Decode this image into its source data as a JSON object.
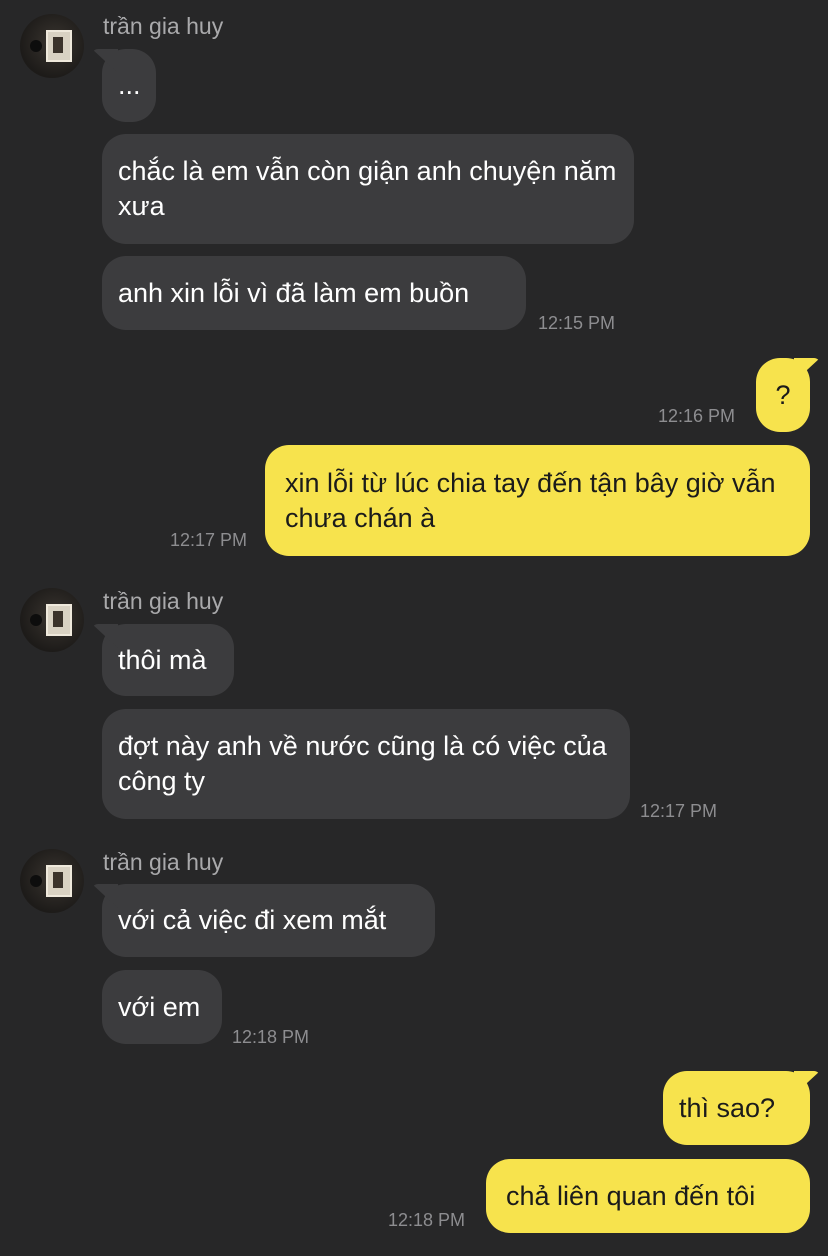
{
  "messages": [
    {
      "sender": "trần gia huy",
      "texts": [
        "...",
        "chắc là em vẫn còn giận anh chuyện năm xưa",
        "anh xin lỗi vì đã làm em buồn"
      ],
      "time": "12:15 PM"
    },
    {
      "outgoing_1": "?",
      "time": "12:16 PM"
    },
    {
      "outgoing_2": "xin lỗi từ lúc chia tay đến tận bây giờ vẫn chưa chán à",
      "time": "12:17 PM"
    },
    {
      "sender": "trần gia huy",
      "texts": [
        "thôi mà",
        "đợt này anh về nước cũng là có việc của công ty"
      ],
      "time": "12:17 PM"
    },
    {
      "sender": "trần gia huy",
      "texts": [
        "với cả việc đi xem mắt",
        "với em"
      ],
      "time": "12:18 PM"
    },
    {
      "outgoing": [
        "thì sao?",
        "chả liên quan đến tôi"
      ],
      "time": "12:18 PM"
    }
  ],
  "colors": {
    "background": "#272728",
    "incoming": "#3c3c3e",
    "outgoing": "#f7e34d"
  },
  "icons": {
    "avatar": "profile-photo"
  }
}
